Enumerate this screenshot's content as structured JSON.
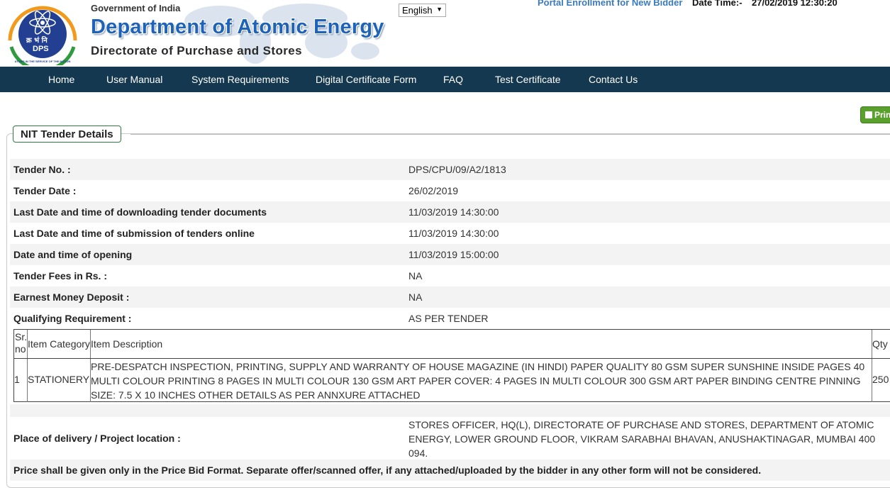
{
  "header": {
    "gov": "Government of India",
    "dept": "Department of Atomic Energy",
    "directorate": "Directorate of Purchase and Stores",
    "logo_text": "DPS",
    "logo_hindi": "क्र भं नि",
    "logo_ring_text": "ATOMS IN THE SERVICE OF THE NATION",
    "language": "English",
    "enrollment_link": "Portal Enrollment for New Bidder",
    "datetime_label": "Date Time:-",
    "datetime_value": "27/02/2019 12:30:20"
  },
  "nav": [
    "Home",
    "User Manual",
    "System Requirements",
    "Digital Certificate Form",
    "FAQ",
    "Test Certificate",
    "Contact Us"
  ],
  "print_label": "Print",
  "section_title": "NIT Tender Details",
  "fields": [
    {
      "label": "Tender No. :",
      "value": "DPS/CPU/09/A2/1813"
    },
    {
      "label": "Tender Date :",
      "value": "26/02/2019"
    },
    {
      "label": "Last Date and time of downloading tender documents",
      "value": "11/03/2019 14:30:00"
    },
    {
      "label": "Last Date and time of submission of tenders online",
      "value": "11/03/2019 14:30:00"
    },
    {
      "label": "Date and time of opening",
      "value": "11/03/2019 15:00:00"
    },
    {
      "label": "Tender Fees in Rs. :",
      "value": "NA"
    },
    {
      "label": "Earnest Money Deposit :",
      "value": "NA"
    },
    {
      "label": "Qualifying Requirement :",
      "value": "AS PER TENDER"
    }
  ],
  "items_table": {
    "headers": [
      "Sr. no",
      "Item Category",
      "Item Description",
      "Qty"
    ],
    "rows": [
      {
        "sr": "1",
        "category": "STATIONERY",
        "description": "PRE-DESPATCH INSPECTION, PRINTING, SUPPLY AND WARRANTY OF HOUSE MAGAZINE (IN HINDI) PAPER QUALITY 80 GSM SUPER SUNSHINE INSIDE PAGES 40 MULTI COLOUR PRINTING 8 PAGES IN MULTI COLOUR 130 GSM ART PAPER COVER: 4 PAGES IN MULTI COLOUR 300 GSM ART PAPER BINDING CENTRE PINNING SIZE: 7.5 X 10 INCHES OTHER DETAILS AS PER ANNXURE ATTACHED",
        "qty": "250"
      }
    ]
  },
  "delivery": {
    "label": "Place of delivery / Project location :",
    "value": "STORES OFFICER, HQ(L), DIRECTORATE OF PURCHASE AND STORES, DEPARTMENT OF ATOMIC ENERGY, LOWER GROUND FLOOR, VIKRAM SARABHAI BHAVAN, ANUSHAKTINAGAR, MUMBAI 400 094."
  },
  "note": "Price shall be given only in the Price Bid Format. Separate offer/scanned offer, if any attached/uploaded by the bidder in any other form will not be considered.",
  "colors": {
    "nav_bg": "#14384f",
    "dept_blue": "#1f63b9",
    "link_blue": "#3a7bbf",
    "print_green": "#5aa02c"
  },
  "icons": [
    "dps-logo",
    "world-map-watermark",
    "printer-icon",
    "dropdown-arrow-icon"
  ]
}
